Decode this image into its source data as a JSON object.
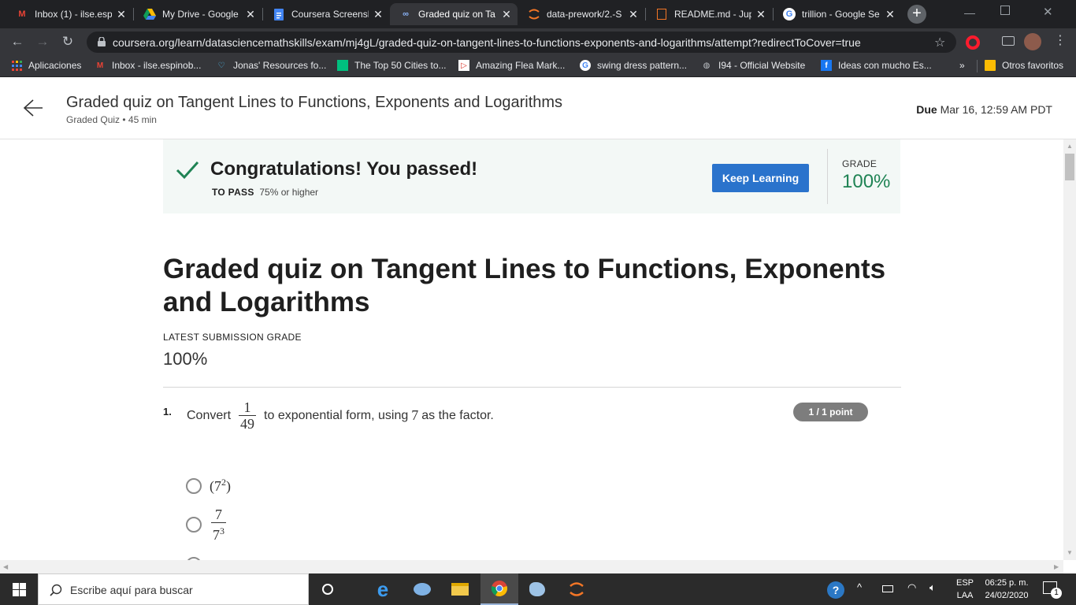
{
  "browser": {
    "tabs": [
      {
        "title": "Inbox (1) - ilse.esp",
        "icon": "gmail-icon",
        "icon_color": "#ea4335"
      },
      {
        "title": "My Drive - Google",
        "icon": "drive-icon",
        "icon_color": "#fbbc04"
      },
      {
        "title": "Coursera Screensh",
        "icon": "docs-icon",
        "icon_color": "#4285f4"
      },
      {
        "title": "Graded quiz on Ta",
        "icon": "coursera-icon",
        "icon_color": "#2a73cc"
      },
      {
        "title": "data-prework/2.-S",
        "icon": "jupyter-icon",
        "icon_color": "#f37626"
      },
      {
        "title": "README.md - Jup",
        "icon": "jupyter-file-icon",
        "icon_color": "#f37626"
      },
      {
        "title": "trillion - Google Se",
        "icon": "google-icon",
        "icon_color": "#4285f4"
      }
    ],
    "active_tab": 3,
    "url": "coursera.org/learn/datasciencemathskills/exam/mj4gL/graded-quiz-on-tangent-lines-to-functions-exponents-and-logarithms/attempt?redirectToCover=true",
    "bookmarks": [
      {
        "label": "Aplicaciones",
        "icon": "apps-grid-icon"
      },
      {
        "label": "Inbox - ilse.espinob...",
        "icon": "gmail-icon"
      },
      {
        "label": "Jonas' Resources fo...",
        "icon": "heart-icon"
      },
      {
        "label": "The Top 50 Cities to...",
        "icon": "green-square-icon"
      },
      {
        "label": "Amazing Flea Mark...",
        "icon": "red-flag-icon"
      },
      {
        "label": "swing dress pattern...",
        "icon": "google-icon"
      },
      {
        "label": "I94 - Official Website",
        "icon": "globe-icon"
      },
      {
        "label": "Ideas con mucho Es...",
        "icon": "facebook-icon"
      }
    ],
    "bookmarks_more": "»",
    "other_bookmarks": "Otros favoritos"
  },
  "header": {
    "title": "Graded quiz on Tangent Lines to Functions, Exponents and Logarithms",
    "subtitle": "Graded Quiz • 45 min",
    "due_label": "Due",
    "due_value": "Mar 16, 12:59 AM PDT"
  },
  "banner": {
    "congrats": "Congratulations! You passed!",
    "to_pass_label": "TO PASS",
    "to_pass_value": "75% or higher",
    "keep_learning": "Keep Learning",
    "grade_label": "GRADE",
    "grade_value": "100%",
    "success_color": "#1f8354",
    "button_color": "#2a73cc"
  },
  "quiz": {
    "title": "Graded quiz on Tangent Lines to Functions, Exponents and Logarithms",
    "latest_label": "LATEST SUBMISSION GRADE",
    "latest_value": "100%",
    "question": {
      "number": "1.",
      "text_before": "Convert",
      "fraction_num": "1",
      "fraction_den": "49",
      "text_middle": "to exponential form, using",
      "factor": "7",
      "text_after": "as the factor.",
      "points": "1 / 1 point",
      "options": [
        {
          "base": "(7",
          "exp": "2",
          "close": ")"
        },
        {
          "num": "7",
          "den_base": "7",
          "den_exp": "3"
        }
      ]
    }
  },
  "taskbar": {
    "search_placeholder": "Escribe aquí para buscar",
    "lang_top": "ESP",
    "lang_bottom": "LAA",
    "time": "06:25 p. m.",
    "date": "24/02/2020",
    "notifications": "1"
  }
}
